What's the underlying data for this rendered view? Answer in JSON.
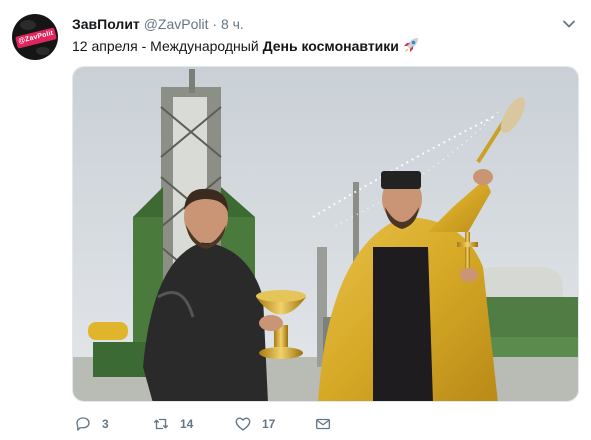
{
  "tweet": {
    "author_name": "ЗавПолит",
    "handle": "@ZavPolit",
    "separator": "·",
    "time": "8 ч.",
    "text_prefix": "12 апреля - Международный ",
    "text_bold": "День космонавтики",
    "avatar_label": "@ZavPolit",
    "rocket_icon": "rocket-emoji"
  },
  "actions": {
    "replies": "3",
    "retweets": "14",
    "likes": "17"
  },
  "colors": {
    "text_primary": "#14171a",
    "text_secondary": "#657786",
    "avatar_accent": "#e0245e"
  }
}
